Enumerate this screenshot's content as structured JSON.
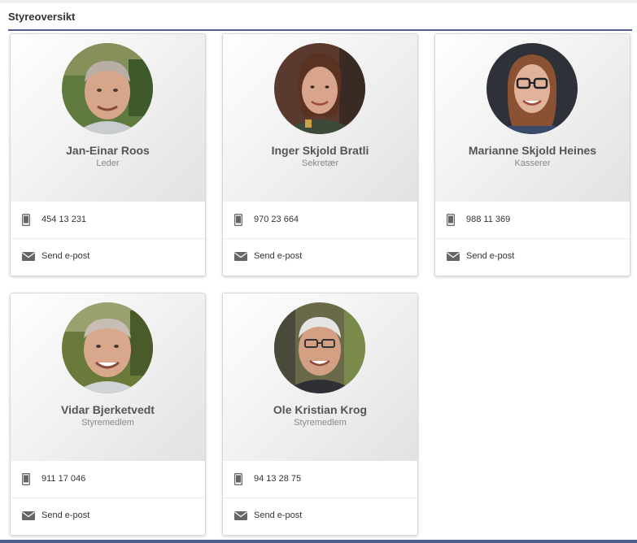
{
  "header": {
    "title": "Styreoversikt"
  },
  "members": [
    {
      "name": "Jan-Einar Roos",
      "role": "Leder",
      "phone": "454 13 231",
      "email_label": "Send e-post"
    },
    {
      "name": "Inger Skjold Bratli",
      "role": "Sekretær",
      "phone": "970 23 664",
      "email_label": "Send e-post"
    },
    {
      "name": "Marianne Skjold Heines",
      "role": "Kasserer",
      "phone": "988 11 369",
      "email_label": "Send e-post"
    },
    {
      "name": "Vidar Bjerketvedt",
      "role": "Styremedlem",
      "phone": "911 17 046",
      "email_label": "Send e-post"
    },
    {
      "name": "Ole Kristian Krog",
      "role": "Styremedlem",
      "phone": "94 13 28 75",
      "email_label": "Send e-post"
    }
  ],
  "icons": {
    "phone": "mobile-phone-icon",
    "email": "envelope-icon"
  },
  "colors": {
    "header_underline": "#4f5e8e",
    "icon": "#666666"
  }
}
